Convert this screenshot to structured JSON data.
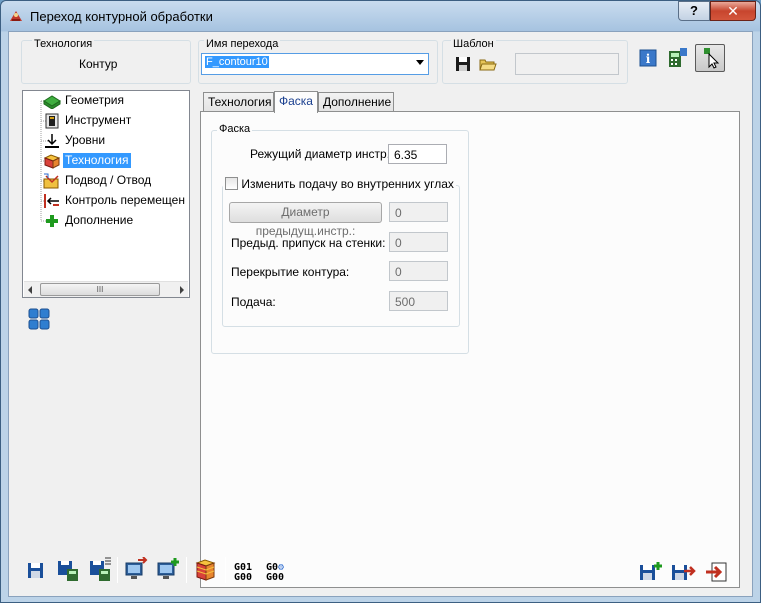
{
  "window": {
    "title": "Переход контурной обработки",
    "help_label": "?",
    "close_label": "✕"
  },
  "header": {
    "tech_group_label": "Технология",
    "tech_value": "Контур",
    "name_group_label": "Имя перехода",
    "name_value": "F_contour10",
    "template_group_label": "Шаблон"
  },
  "tree": {
    "items": [
      {
        "label": "Геометрия",
        "icon": "geometry-icon"
      },
      {
        "label": "Инструмент",
        "icon": "tool-icon"
      },
      {
        "label": "Уровни",
        "icon": "levels-icon"
      },
      {
        "label": "Технология",
        "icon": "technology-icon",
        "selected": true
      },
      {
        "label": "Подвод / Отвод",
        "icon": "approach-icon"
      },
      {
        "label": "Контроль перемещен",
        "icon": "motion-control-icon"
      },
      {
        "label": "Дополнение",
        "icon": "addition-icon"
      }
    ],
    "scroll_thumb": "III"
  },
  "tabs": [
    {
      "label": "Технология"
    },
    {
      "label": "Фаска",
      "active": true
    },
    {
      "label": "Дополнение"
    }
  ],
  "chamfer": {
    "group_label": "Фаска",
    "cut_diameter_label": "Режущий диаметр инстр.:",
    "cut_diameter_value": "6.35",
    "inner_corner_checkbox_label": "Изменить подачу во внутренних углах",
    "prev_diameter_button": "Диаметр предыдущ.инстр.:",
    "prev_diameter_value": "0",
    "prev_allowance_label": "Предыд. припуск на стенки:",
    "prev_allowance_value": "0",
    "overlap_label": "Перекрытие контура:",
    "overlap_value": "0",
    "feed_label": "Подача:",
    "feed_value": "500"
  },
  "toolbar": {
    "g1_top": "G01",
    "g1_bottom": "G00",
    "g2_top": "G0",
    "g2_bottom": "G00"
  },
  "colors": {
    "selection": "#3399ff",
    "title_bar": "#a6c3e0"
  }
}
